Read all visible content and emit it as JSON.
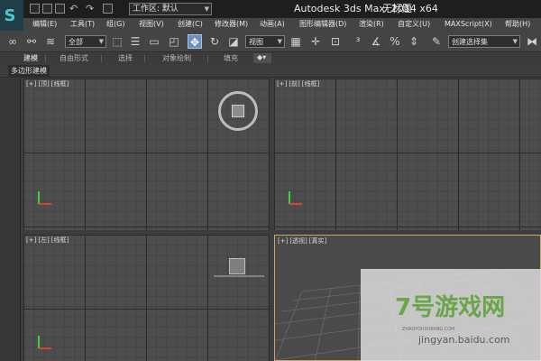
{
  "titlebar": {
    "workspace_label": "工作区: 默认",
    "app_title": "Autodesk 3ds Max  2014 x64",
    "file_name": "无标题"
  },
  "menu": {
    "items": [
      "编辑(E)",
      "工具(T)",
      "组(G)",
      "视图(V)",
      "创建(C)",
      "修改器(M)",
      "动画(A)",
      "图形编辑器(D)",
      "渲染(R)",
      "自定义(U)",
      "MAXScript(X)",
      "帮助(H)"
    ]
  },
  "toolbar": {
    "filter_value": "全部",
    "refcoord_value": "视图",
    "selection_set_placeholder": "创建选择集"
  },
  "ribbon": {
    "tabs": [
      "建模",
      "自由形式",
      "选择",
      "对象绘制",
      "填充"
    ],
    "active_tab": "建模",
    "panel_label": "多边形建模"
  },
  "viewports": {
    "top": {
      "plus": "[+]",
      "name": "[顶]",
      "shade": "[线框]"
    },
    "front": {
      "plus": "[+]",
      "name": "[前]",
      "shade": "[线框]"
    },
    "left": {
      "plus": "[+]",
      "name": "[左]",
      "shade": "[线框]"
    },
    "persp": {
      "plus": "[+]",
      "name": "[透视]",
      "shade": "[真实]"
    }
  },
  "watermark": {
    "brand": "7号游戏网",
    "small_text": "ZHAOYOUXIWANG.COM",
    "url": "jingyan.baidu.com"
  },
  "colors": {
    "active_viewport_border": "#caa86a",
    "selected_tool": "#6c90b8",
    "axis_x": "#d84040",
    "axis_y": "#3fcf3f"
  }
}
